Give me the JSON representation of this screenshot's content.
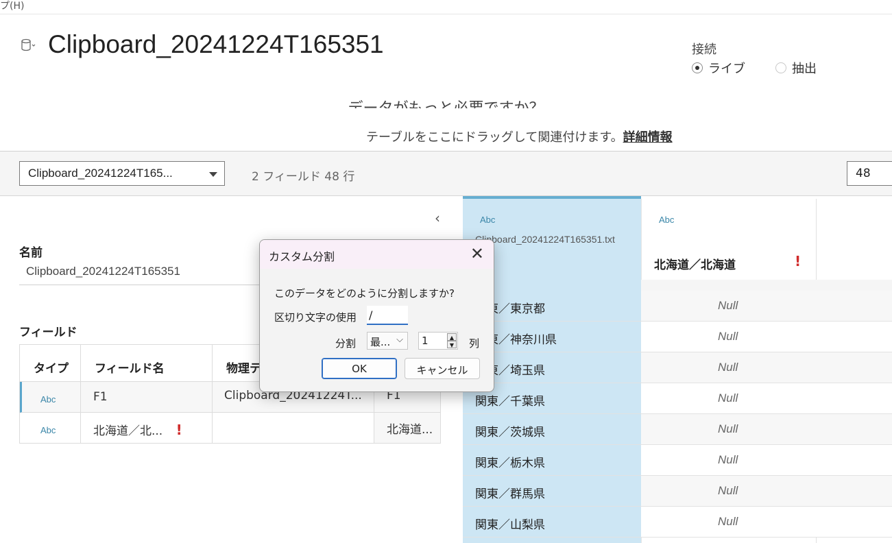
{
  "menu": {
    "help_fragment": "プ(H)"
  },
  "header": {
    "title": "Clipboard_20241224T165351",
    "connection": {
      "label": "接続",
      "live_label": "ライブ",
      "extract_label": "抽出",
      "selected": "live"
    }
  },
  "canvas": {
    "partial_heading": "データがもっと必要ですか？",
    "drag_hint": "テーブルをここにドラッグして関連付けます。",
    "more_info_link": "詳細情報"
  },
  "toolbar": {
    "table_select_value": "Clipboard_20241224T165...",
    "counts": "2 フィールド 48 行",
    "rows_value": "48"
  },
  "left_panel": {
    "collapse_glyph": "‹",
    "name_label": "名前",
    "name_value": "Clipboard_20241224T165351",
    "fields_label": "フィールド",
    "fields_table": {
      "headers": [
        "タイプ",
        "フィールド名",
        "物理テ"
      ],
      "rows": [
        {
          "type": "Abc",
          "name": "F1",
          "physical": "Clipboard_20241224T...",
          "remote": "F1"
        },
        {
          "type": "Abc",
          "name": "北海道／北...",
          "warning": "!",
          "physical": "",
          "remote": "北海道..."
        }
      ]
    }
  },
  "grid": {
    "col1": {
      "type": "Abc",
      "source": "Clipboard_20241224T165351.txt"
    },
    "col2": {
      "type": "Abc",
      "name": "北海道／北海道",
      "warning": "!"
    },
    "rows": [
      {
        "c1": "関東／東京都",
        "c2": "Null"
      },
      {
        "c1": "関東／神奈川県",
        "c2": "Null"
      },
      {
        "c1": "関東／埼玉県",
        "c2": "Null"
      },
      {
        "c1": "関東／千葉県",
        "c2": "Null"
      },
      {
        "c1": "関東／茨城県",
        "c2": "Null"
      },
      {
        "c1": "関東／栃木県",
        "c2": "Null"
      },
      {
        "c1": "関東／群馬県",
        "c2": "Null"
      },
      {
        "c1": "関東／山梨県",
        "c2": "Null"
      }
    ]
  },
  "dialog": {
    "title": "カスタム分割",
    "close_glyph": "✕",
    "question": "このデータをどのように分割しますか?",
    "delimiter_label": "区切り文字の使用",
    "delimiter_value": "/",
    "split_label": "分割",
    "split_select_value": "最...",
    "split_count": "1",
    "columns_label": "列",
    "ok_label": "OK",
    "cancel_label": "キャンセル"
  },
  "icons": {
    "db": "database-icon",
    "caret": "chevron-down-icon",
    "close": "close-icon",
    "warning": "exclamation-icon"
  },
  "colors": {
    "accent": "#2f6fc4",
    "selected_column": "#cde6f4",
    "warning": "#d02c2c",
    "type_badge": "#3a86a8"
  }
}
